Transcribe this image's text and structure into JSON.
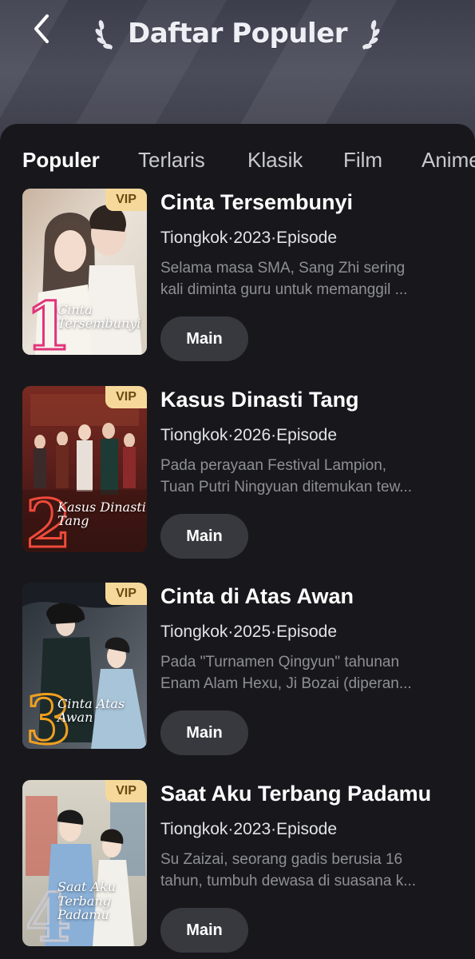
{
  "header": {
    "title": "Daftar Populer",
    "back_icon": "chevron-left-icon",
    "laurel_icon": "laurel-icon"
  },
  "tabs": [
    {
      "label": "Populer",
      "active": true
    },
    {
      "label": "Terlaris",
      "active": false
    },
    {
      "label": "Klasik",
      "active": false
    },
    {
      "label": "Film",
      "active": false
    },
    {
      "label": "Anime",
      "active": false
    }
  ],
  "items": [
    {
      "rank": "1",
      "badge": "VIP",
      "title": "Cinta Tersembunyi",
      "poster_title": "Cinta Tersembunyi",
      "meta": "Tiongkok·2023·Episode",
      "desc_line1": "Selama masa SMA, Sang Zhi sering",
      "desc_line2": "kali diminta guru untuk memanggil ...",
      "button": "Main",
      "rank_color": "#e0357a"
    },
    {
      "rank": "2",
      "badge": "VIP",
      "title": "Kasus Dinasti Tang",
      "poster_title": "Kasus Dinasti Tang",
      "meta": "Tiongkok·2026·Episode",
      "desc_line1": "Pada perayaan Festival Lampion,",
      "desc_line2": "Tuan Putri Ningyuan ditemukan tew...",
      "button": "Main",
      "rank_color": "#f04a3a"
    },
    {
      "rank": "3",
      "badge": "VIP",
      "title": "Cinta di Atas Awan",
      "poster_title": "Cinta Atas Awan",
      "meta": "Tiongkok·2025·Episode",
      "desc_line1": "Pada \"Turnamen Qingyun\" tahunan",
      "desc_line2": "Enam Alam Hexu, Ji Bozai (diperan...",
      "button": "Main",
      "rank_color": "#f0a020"
    },
    {
      "rank": "4",
      "badge": "VIP",
      "title": "Saat Aku Terbang Padamu",
      "poster_title": "Saat Aku Terbang Padamu",
      "meta": "Tiongkok·2023·Episode",
      "desc_line1": "Su Zaizai, seorang gadis berusia 16",
      "desc_line2": "tahun, tumbuh dewasa di suasana k...",
      "button": "Main",
      "rank_color": "#c8c8d0"
    }
  ]
}
